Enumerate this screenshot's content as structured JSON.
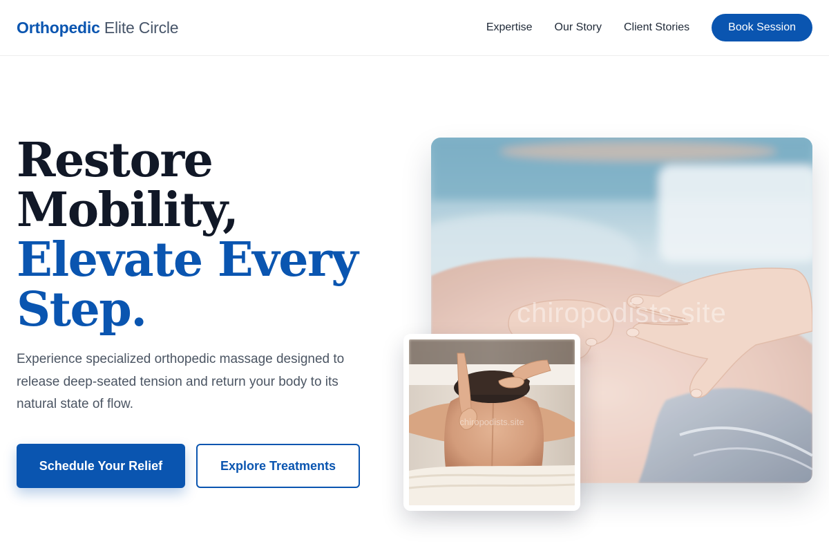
{
  "header": {
    "brand_strong": "Orthopedic",
    "brand_light": "Elite Circle",
    "nav": [
      {
        "label": "Expertise"
      },
      {
        "label": "Our Story"
      },
      {
        "label": "Client Stories"
      }
    ],
    "cta_label": "Book Session"
  },
  "hero": {
    "title_line1": "Restore",
    "title_line2": "Mobility,",
    "title_line3": "Elevate Every",
    "title_line4": "Step.",
    "description": "Experience specialized orthopedic massage designed to release deep-seated tension and return your body to its natural state of flow.",
    "primary_button": "Schedule Your Relief",
    "secondary_button": "Explore Treatments"
  },
  "images": {
    "main_watermark": "chiropodists.site",
    "inset_watermark": "chiropodists.site"
  },
  "colors": {
    "brand_blue": "#0a55b0",
    "heading_dark": "#111827",
    "body_gray": "#4b5563"
  }
}
